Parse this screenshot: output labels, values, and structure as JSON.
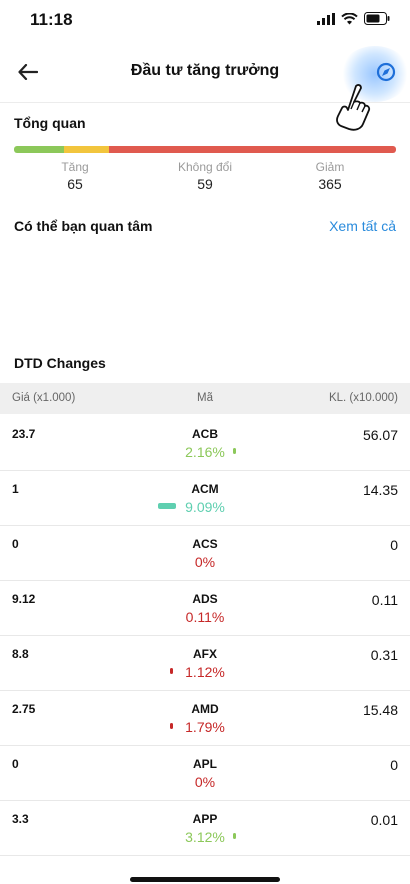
{
  "status_bar": {
    "time": "11:18"
  },
  "header": {
    "title": "Đầu tư tăng trưởng"
  },
  "overview": {
    "title": "Tổng quan",
    "bar": {
      "up_fraction": 0.1,
      "flat_fraction": 0.0,
      "down_fraction": 0.9,
      "colors": {
        "up": "#8cc85a",
        "flat": "#f2c53d",
        "down": "#e05a4f"
      }
    },
    "stats": [
      {
        "label": "Tăng",
        "value": "65"
      },
      {
        "label": "Không đổi",
        "value": "59"
      },
      {
        "label": "Giảm",
        "value": "365"
      }
    ]
  },
  "interest": {
    "title": "Có thể bạn quan tâm",
    "see_all": "Xem tất cả"
  },
  "dtd": {
    "title": "DTD Changes",
    "columns": {
      "price": "Giá (x1.000)",
      "code": "Mã",
      "volume": "KL. (x10.000)"
    },
    "rows": [
      {
        "price": "23.7",
        "code": "ACB",
        "pct": "2.16%",
        "volume": "56.07",
        "trend": "up",
        "indicator": 0.05
      },
      {
        "price": "1",
        "code": "ACM",
        "pct": "9.09%",
        "volume": "14.35",
        "trend": "ceiling",
        "indicator": 0.9
      },
      {
        "price": "0",
        "code": "ACS",
        "pct": "0%",
        "volume": "0",
        "trend": "down",
        "indicator": 0
      },
      {
        "price": "9.12",
        "code": "ADS",
        "pct": "0.11%",
        "volume": "0.11",
        "trend": "down",
        "indicator": 0
      },
      {
        "price": "8.8",
        "code": "AFX",
        "pct": "1.12%",
        "volume": "0.31",
        "trend": "down",
        "indicator": 0.03
      },
      {
        "price": "2.75",
        "code": "AMD",
        "pct": "1.79%",
        "volume": "15.48",
        "trend": "down",
        "indicator": 0.05
      },
      {
        "price": "0",
        "code": "APL",
        "pct": "0%",
        "volume": "0",
        "trend": "down",
        "indicator": 0
      },
      {
        "price": "3.3",
        "code": "APP",
        "pct": "3.12%",
        "volume": "0.01",
        "trend": "up",
        "indicator": 0.08
      }
    ],
    "colors": {
      "up": "#8cc85a",
      "ceiling": "#5fcfb0",
      "down": "#c62828"
    }
  },
  "icons": [
    "back-arrow-icon",
    "compass-icon",
    "pointer-hand-icon",
    "signal-icon",
    "wifi-icon",
    "battery-icon"
  ]
}
